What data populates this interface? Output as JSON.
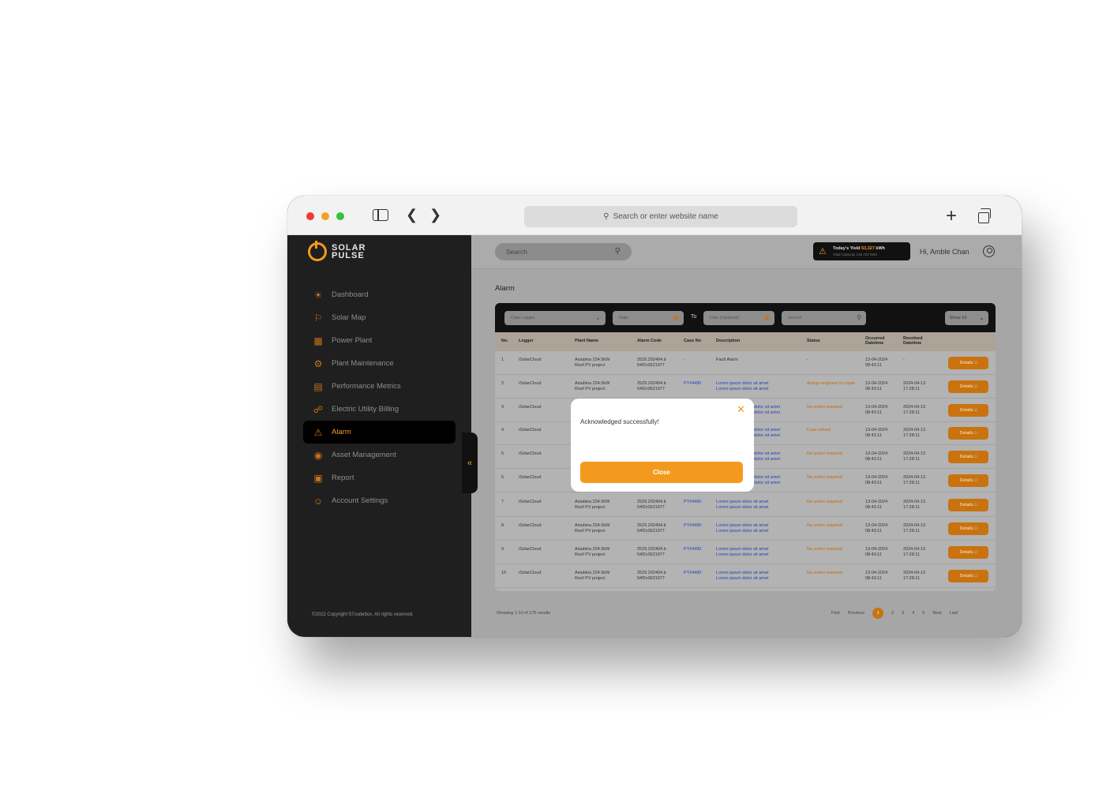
{
  "browser": {
    "url_placeholder": "Search or enter website name"
  },
  "sidebar": {
    "logo_line1": "SOLAR",
    "logo_line2": "PULSE",
    "items": [
      {
        "label": "Dashboard",
        "icon": "sun-icon"
      },
      {
        "label": "Solar Map",
        "icon": "map-pin-icon"
      },
      {
        "label": "Power Plant",
        "icon": "plant-icon"
      },
      {
        "label": "Plant Maintenance",
        "icon": "maintenance-icon"
      },
      {
        "label": "Performance Metrics",
        "icon": "chart-icon"
      },
      {
        "label": "Electric Utility Billing",
        "icon": "billing-icon"
      },
      {
        "label": "Alarm",
        "icon": "alarm-icon"
      },
      {
        "label": "Asset Management",
        "icon": "asset-icon"
      },
      {
        "label": "Report",
        "icon": "folder-icon"
      },
      {
        "label": "Account Settings",
        "icon": "user-settings-icon"
      }
    ],
    "collapse_glyph": "«",
    "copyright": "©2022 Copyright 57codebox. All rights reserved."
  },
  "topbar": {
    "search_placeholder": "Search",
    "yield_label": "Today's Yield",
    "yield_value": "53,327",
    "yield_unit": "kWh",
    "capacity_text": "Total Capacity 145,722 kWh",
    "greeting": "Hi, Amble Chan"
  },
  "page": {
    "title": "Alarm"
  },
  "filters": {
    "logger_placeholder": "Data Logger",
    "date_placeholder": "Date",
    "to_label": "To",
    "date2_placeholder": "Date (Optional)",
    "search_placeholder": "Search",
    "show_label": "Show 10"
  },
  "table": {
    "headers": {
      "no": "No.",
      "logger": "Logger",
      "plant": "Plant Name",
      "code": "Alarm Code",
      "case": "Case No",
      "desc": "Description",
      "status": "Status",
      "occurred1": "Occurred",
      "occurred2": "Datetime",
      "resolved1": "Resolved",
      "resolved2": "Datetime"
    },
    "rows": [
      {
        "no": "1",
        "logger": "iSolarCloud",
        "plant1": "Asiabina 234.5kW",
        "plant2": "Roof PV project",
        "code1": "2529.202404.b",
        "code2": "54f2c0621977",
        "case": "-",
        "desc1": "Fault Alarm",
        "desc2": "",
        "status": "-",
        "occ1": "13-04-2024",
        "occ2": "08:43:11",
        "res1": "-",
        "res2": "",
        "btn": "Details"
      },
      {
        "no": "2",
        "logger": "iSolarCloud",
        "plant1": "Asiabina 234.5kW",
        "plant2": "Roof PV project",
        "code1": "2529.202404.b",
        "code2": "54f2c0621977",
        "case": "PT#4490",
        "desc1": "Lorem ipsum dolor sit amet",
        "desc2": "Lorem ipsum dolor sit amet",
        "status": "Assign engineer to repair",
        "occ1": "13-04-2024",
        "occ2": "08:43:11",
        "res1": "2024-04-13",
        "res2": "17:28:11",
        "btn": "Details"
      },
      {
        "no": "3",
        "logger": "iSolarCloud",
        "plant1": "",
        "plant2": "",
        "code1": "",
        "code2": "",
        "case": "",
        "desc1": "dolor sit amet",
        "desc2": "dolor sit amet",
        "status": "No action required",
        "occ1": "13-04-2024",
        "occ2": "08:43:11",
        "res1": "2024-04-13",
        "res2": "17:28:11",
        "btn": "Details"
      },
      {
        "no": "4",
        "logger": "iSolarCloud",
        "plant1": "",
        "plant2": "",
        "code1": "",
        "code2": "",
        "case": "",
        "desc1": "dolor sit amet",
        "desc2": "dolor sit amet",
        "status": "Case solved",
        "occ1": "13-04-2024",
        "occ2": "08:43:11",
        "res1": "2024-04-13",
        "res2": "17:28:11",
        "btn": "Details"
      },
      {
        "no": "5",
        "logger": "iSolarCloud",
        "plant1": "",
        "plant2": "",
        "code1": "",
        "code2": "",
        "case": "",
        "desc1": "dolor sit amet",
        "desc2": "dolor sit amet",
        "status": "No action required",
        "occ1": "13-04-2024",
        "occ2": "08:43:11",
        "res1": "2024-04-13",
        "res2": "17:28:11",
        "btn": "Details"
      },
      {
        "no": "6",
        "logger": "iSolarCloud",
        "plant1": "",
        "plant2": "",
        "code1": "",
        "code2": "",
        "case": "",
        "desc1": "dolor sit amet",
        "desc2": "dolor sit amet",
        "status": "No action required",
        "occ1": "13-04-2024",
        "occ2": "08:43:11",
        "res1": "2024-04-13",
        "res2": "17:28:11",
        "btn": "Details"
      },
      {
        "no": "7",
        "logger": "iSolarCloud",
        "plant1": "Asiabina 234.5kW",
        "plant2": "Roof PV project",
        "code1": "2529.202404.b",
        "code2": "54f2c0621977",
        "case": "PT#4490",
        "desc1": "Lorem ipsum dolor sit amet",
        "desc2": "Lorem ipsum dolor sit amet",
        "status": "No action required",
        "occ1": "13-04-2024",
        "occ2": "08:43:11",
        "res1": "2024-04-13",
        "res2": "17:28:11",
        "btn": "Details"
      },
      {
        "no": "8",
        "logger": "iSolarCloud",
        "plant1": "Asiabina 234.5kW",
        "plant2": "Roof PV project",
        "code1": "2529.202404.b",
        "code2": "54f2c0621977",
        "case": "PT#4490",
        "desc1": "Lorem ipsum dolor sit amet",
        "desc2": "Lorem ipsum dolor sit amet",
        "status": "No action required",
        "occ1": "13-04-2024",
        "occ2": "08:43:11",
        "res1": "2024-04-13",
        "res2": "17:28:11",
        "btn": "Details"
      },
      {
        "no": "9",
        "logger": "iSolarCloud",
        "plant1": "Asiabina 234.5kW",
        "plant2": "Roof PV project",
        "code1": "2529.202404.b",
        "code2": "54f2c0621977",
        "case": "PT#4490",
        "desc1": "Lorem ipsum dolor sit amet",
        "desc2": "Lorem ipsum dolor sit amet",
        "status": "No action required",
        "occ1": "13-04-2024",
        "occ2": "08:43:11",
        "res1": "2024-04-13",
        "res2": "17:28:11",
        "btn": "Details"
      },
      {
        "no": "10",
        "logger": "iSolarCloud",
        "plant1": "Asiabina 234.5kW",
        "plant2": "Roof PV project",
        "code1": "2529.202404.b",
        "code2": "54f2c0621977",
        "case": "PT#4490",
        "desc1": "Lorem ipsum dolor sit amet",
        "desc2": "Lorem ipsum dolor sit amet",
        "status": "No action required",
        "occ1": "13-04-2024",
        "occ2": "08:43:11",
        "res1": "2024-04-13",
        "res2": "17:28:11",
        "btn": "Details"
      }
    ]
  },
  "pagination": {
    "summary": "Showing 1-10 of 175 results",
    "first": "First",
    "previous": "Previous",
    "pages": [
      "1",
      "2",
      "3",
      "4",
      "5"
    ],
    "current_page": "1",
    "next": "Next",
    "last": "Last"
  },
  "modal": {
    "message": "Acknowledged successfully!",
    "close_label": "Close",
    "close_glyph": "✕"
  },
  "colors": {
    "accent": "#f39a1e",
    "sidebar_bg": "#1f1f1f",
    "link_blue": "#2343b7"
  }
}
